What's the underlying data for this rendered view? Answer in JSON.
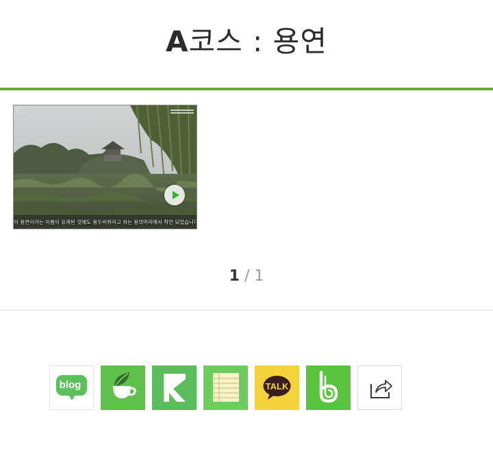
{
  "header": {
    "title_bold": "A",
    "title_rest": "코스 : 용연"
  },
  "media": {
    "thumbnail_caption": "이 용연이라는 이름이 유래된 것에도 용두비위라고 하는 용의머리에서 착안 되었습니다",
    "play_icon": "play-icon"
  },
  "pagination": {
    "current": "1",
    "separator": " / ",
    "total": "1"
  },
  "share": {
    "blog_label": "blog",
    "talk_label": "TALK",
    "icons": [
      "naver-blog-icon",
      "naver-cafe-icon",
      "naver-keep-icon",
      "naver-memo-icon",
      "kakaotalk-icon",
      "band-icon",
      "share-icon"
    ],
    "colors": {
      "cafe": "#5fc14c",
      "keep": "#5cbd5a",
      "memo": "#6ccd5e",
      "kakao": "#f2d33b",
      "band": "#57c43c",
      "accent": "#6aaa3c"
    }
  }
}
